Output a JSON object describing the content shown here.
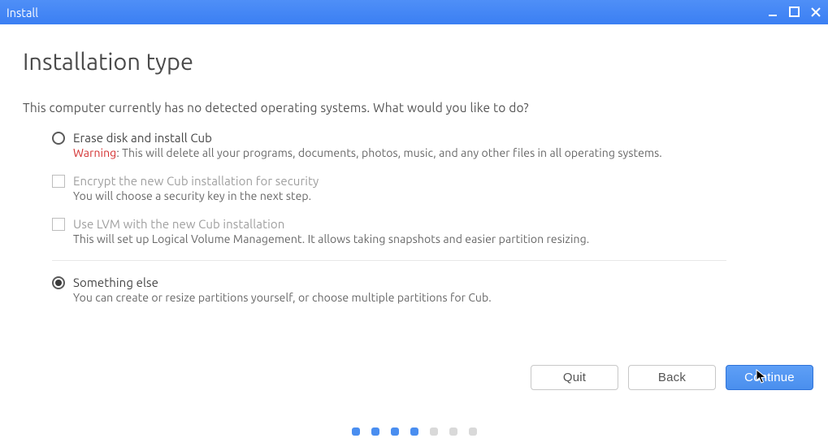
{
  "titlebar": {
    "title": "Install"
  },
  "page": {
    "title": "Installation type",
    "question": "This computer currently has no detected operating systems. What would you like to do?"
  },
  "options": {
    "erase": {
      "label": "Erase disk and install Cub",
      "warn_prefix": "Warning",
      "warn_text": ": This will delete all your programs, documents, photos, music, and any other files in all operating systems."
    },
    "encrypt": {
      "label": "Encrypt the new Cub installation for security",
      "desc": "You will choose a security key in the next step."
    },
    "lvm": {
      "label": "Use LVM with the new Cub installation",
      "desc": "This will set up Logical Volume Management. It allows taking snapshots and easier partition resizing."
    },
    "else": {
      "label": "Something else",
      "desc": "You can create or resize partitions yourself, or choose multiple partitions for Cub."
    }
  },
  "buttons": {
    "quit": "Quit",
    "back": "Back",
    "continue": "Continue"
  }
}
